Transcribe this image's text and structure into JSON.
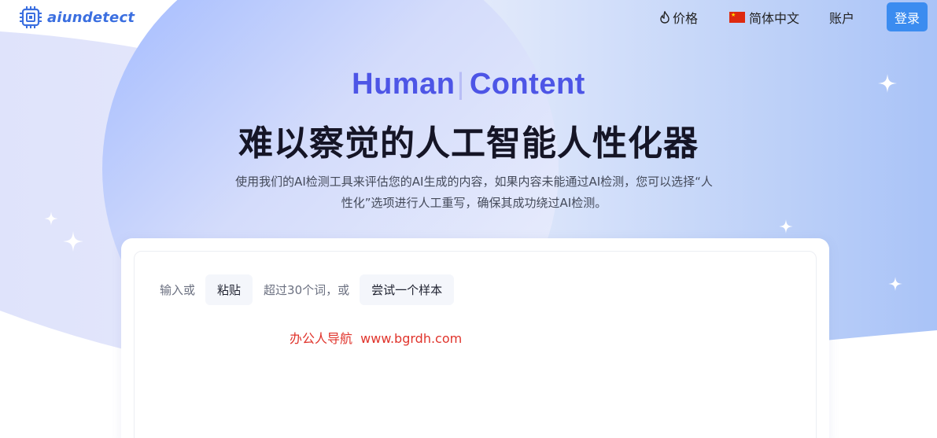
{
  "header": {
    "logo_text": "aiundetect",
    "nav": {
      "pricing_label": "价格",
      "language_label": "简体中文",
      "account_label": "账户",
      "login_label": "登录"
    }
  },
  "hero": {
    "subtitle_left": "Human",
    "subtitle_right": "Content",
    "title": "难以察觉的人工智能人性化器",
    "description_line1": "使用我们的AI检测工具来评估您的AI生成的内容，如果内容未能通过AI检测，您可以选择“人",
    "description_line2": "性化”选项进行人工重写，确保其成功绕过AI检测。"
  },
  "editor": {
    "hint_input": "输入或",
    "paste_label": "粘贴",
    "hint_words": "超过30个词，或",
    "sample_label": "尝试一个样本"
  },
  "watermark": "办公人导航  www.bgrdh.com",
  "colors": {
    "brand_blue": "#3b6fe0",
    "accent_purple": "#4d55e6",
    "login_button": "#3b8cf0",
    "watermark_red": "#e0342c"
  },
  "icons": {
    "logo": "circuit-square-icon",
    "pricing": "fire-icon",
    "language": "china-flag-icon",
    "decoration": "sparkle-icon"
  }
}
